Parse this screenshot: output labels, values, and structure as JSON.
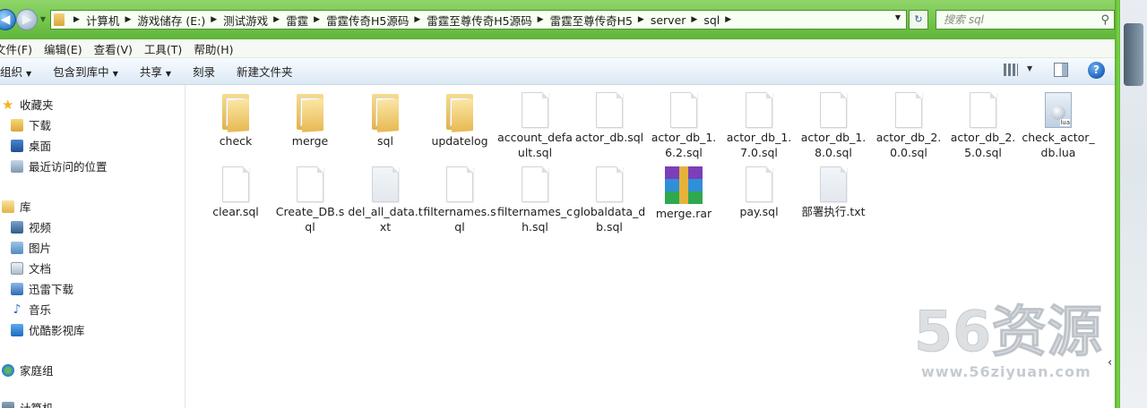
{
  "address": {
    "crumbs": [
      "计算机",
      "游戏储存 (E:)",
      "测试游戏",
      "雷霆",
      "雷霆传奇H5源码",
      "雷霆至尊传奇H5源码",
      "雷霆至尊传奇H5",
      "server",
      "sql"
    ],
    "search_placeholder": "搜索 sql"
  },
  "menu": [
    "文件(F)",
    "编辑(E)",
    "查看(V)",
    "工具(T)",
    "帮助(H)"
  ],
  "toolbar": {
    "organize": "组织",
    "include": "包含到库中",
    "share": "共享",
    "burn": "刻录",
    "new_folder": "新建文件夹"
  },
  "nav": {
    "favorites": "收藏夹",
    "downloads": "下载",
    "desktop": "桌面",
    "recent": "最近访问的位置",
    "libraries": "库",
    "videos": "视频",
    "pictures": "图片",
    "documents": "文档",
    "thunder": "迅雷下载",
    "music": "音乐",
    "youku": "优酷影视库",
    "homegroup": "家庭组",
    "computer": "计算机"
  },
  "files": [
    {
      "name": "check",
      "type": "folder"
    },
    {
      "name": "merge",
      "type": "folder"
    },
    {
      "name": "sql",
      "type": "folder"
    },
    {
      "name": "updatelog",
      "type": "folder"
    },
    {
      "name": "account_default.sql",
      "type": "doc"
    },
    {
      "name": "actor_db.sql",
      "type": "doc"
    },
    {
      "name": "actor_db_1.6.2.sql",
      "type": "doc"
    },
    {
      "name": "actor_db_1.7.0.sql",
      "type": "doc"
    },
    {
      "name": "actor_db_1.8.0.sql",
      "type": "doc"
    },
    {
      "name": "actor_db_2.0.0.sql",
      "type": "doc"
    },
    {
      "name": "actor_db_2.5.0.sql",
      "type": "doc"
    },
    {
      "name": "check_actor_db.lua",
      "type": "lua"
    },
    {
      "name": "clear.sql",
      "type": "doc"
    },
    {
      "name": "Create_DB.sql",
      "type": "doc"
    },
    {
      "name": "del_all_data.txt",
      "type": "txt"
    },
    {
      "name": "filternames.sql",
      "type": "doc"
    },
    {
      "name": "filternames_ch.sql",
      "type": "doc"
    },
    {
      "name": "globaldata_db.sql",
      "type": "doc"
    },
    {
      "name": "merge.rar",
      "type": "rar"
    },
    {
      "name": "pay.sql",
      "type": "doc"
    },
    {
      "name": "部署执行.txt",
      "type": "txt"
    }
  ],
  "watermark": {
    "big": "56资源",
    "small": "www.56ziyuan.com"
  }
}
